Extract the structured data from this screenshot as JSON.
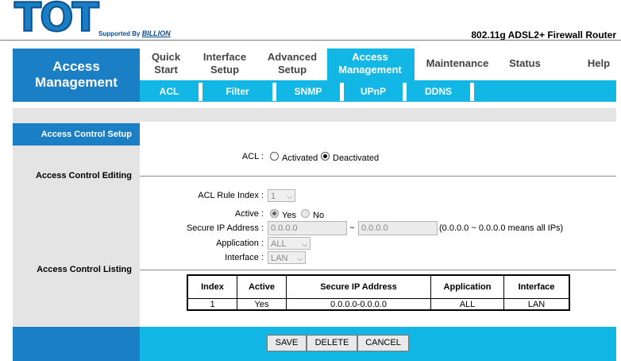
{
  "header": {
    "logo_text": "TOT",
    "logo_sub_prefix": "Supported By",
    "logo_sub_brand": "BILLION",
    "product": "802.11g ADSL2+ Firewall Router"
  },
  "nav": {
    "section_title": "Access Management",
    "tabs": [
      {
        "label": "Quick Start"
      },
      {
        "label": "Interface Setup"
      },
      {
        "label": "Advanced Setup"
      },
      {
        "label": "Access Management",
        "active": true
      },
      {
        "label": "Maintenance"
      },
      {
        "label": "Status"
      },
      {
        "label": "Help"
      }
    ],
    "subtabs": [
      "ACL",
      "Filter",
      "SNMP",
      "UPnP",
      "DDNS"
    ]
  },
  "left": {
    "active_item": "Access Control Setup",
    "editing": "Access Control Editing",
    "listing": "Access Control Listing"
  },
  "form": {
    "acl_label": "ACL :",
    "acl_activated": "Activated",
    "acl_deactivated": "Deactivated",
    "acl_value": "Deactivated",
    "rule_index_label": "ACL Rule Index :",
    "rule_index_value": "1",
    "active_label": "Active :",
    "active_yes": "Yes",
    "active_no": "No",
    "active_value": "Yes",
    "secure_ip_label": "Secure IP Address :",
    "secure_ip_start": "0.0.0.0",
    "tilde": "~",
    "secure_ip_end": "0.0.0.0",
    "secure_ip_hint": "(0.0.0.0 ~ 0.0.0.0 means all IPs)",
    "application_label": "Application :",
    "application_value": "ALL",
    "interface_label": "Interface :",
    "interface_value": "LAN"
  },
  "table": {
    "headers": [
      "Index",
      "Active",
      "Secure IP Address",
      "Application",
      "Interface"
    ],
    "rows": [
      [
        "1",
        "Yes",
        "0.0.0.0-0.0.0.0",
        "ALL",
        "LAN"
      ]
    ]
  },
  "buttons": {
    "save": "SAVE",
    "delete": "DELETE",
    "cancel": "CANCEL"
  }
}
